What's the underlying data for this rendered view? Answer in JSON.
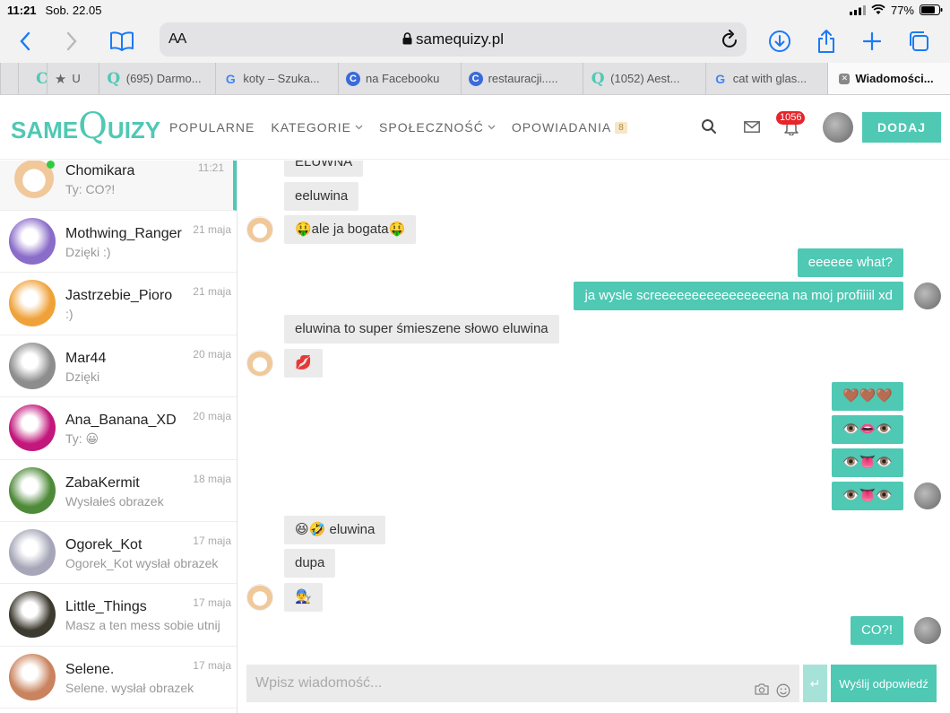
{
  "status": {
    "time": "11:21",
    "date": "Sob. 22.05",
    "battery": "77%"
  },
  "browser": {
    "aa_label": "AA",
    "url": "samequizy.pl",
    "tabs": [
      {
        "label": "U",
        "fav": "Q",
        "favtype": "q"
      },
      {
        "label": "(695) Darmo...",
        "fav": "Q",
        "favtype": "q"
      },
      {
        "label": "koty – Szuka...",
        "fav": "G",
        "favtype": "g"
      },
      {
        "label": "na Facebooku",
        "fav": "C",
        "favtype": "c"
      },
      {
        "label": "restauracji.....",
        "fav": "C",
        "favtype": "c"
      },
      {
        "label": "(1052) Aest...",
        "fav": "Q",
        "favtype": "q"
      },
      {
        "label": "cat with glas...",
        "fav": "G",
        "favtype": "g"
      },
      {
        "label": "Wiadomości...",
        "fav": "✕",
        "favtype": "x"
      }
    ]
  },
  "site": {
    "logo_small": "SAME",
    "logo_big": "Q",
    "logo_rest": "UIZY",
    "nav": {
      "popularne": "POPULARNE",
      "kategorie": "KATEGORIE",
      "spolecznosc": "SPOŁECZNOŚĆ",
      "opowiadania": "OPOWIADANIA",
      "opowiadania_count": "8"
    },
    "notifications": "1056",
    "add_label": "DODAJ"
  },
  "conversations": [
    {
      "name": "Chomikara",
      "preview": "Ty: CO?!",
      "date": "11:21",
      "color": "#f3d6b4"
    },
    {
      "name": "Mothwing_Ranger",
      "preview": "Dzięki :)",
      "date": "21 maja",
      "color": "#8a6cc9"
    },
    {
      "name": "Jastrzebie_Pioro",
      "preview": ":)",
      "date": "21 maja",
      "color": "#f0a23a"
    },
    {
      "name": "Mar44",
      "preview": "Dzięki",
      "date": "20 maja",
      "color": "#8d8d8d"
    },
    {
      "name": "Ana_Banana_XD",
      "preview": "Ty: 😀",
      "date": "20 maja",
      "color": "#c2187c"
    },
    {
      "name": "ZabaKermit",
      "preview": "Wysłałeś obrazek",
      "date": "18 maja",
      "color": "#4f8a3a"
    },
    {
      "name": "Ogorek_Kot",
      "preview": "Ogorek_Kot wysłał obrazek",
      "date": "17 maja",
      "color": "#a6a6b8"
    },
    {
      "name": "Little_Things",
      "preview": "Masz a ten mess sobie utnij",
      "date": "17 maja",
      "color": "#3d3a2f"
    },
    {
      "name": "Selene.",
      "preview": "Selene. wysłał obrazek",
      "date": "17 maja",
      "color": "#c9835e"
    }
  ],
  "messages": [
    "ELUWNA",
    "eeluwina",
    "🤑ale ja bogata🤑",
    "eeeeee what?",
    "ja wysle screeeeeeeeeeeeeeeena na moj profiiiil xd",
    "eluwina to super śmieszene słowo eluwina",
    "💋",
    "🤎🤎🤎",
    "👁️👄👁️",
    "👁️👅👁️",
    "👁️👅👁️",
    "😆🤣 eluwina",
    "dupa",
    "👨‍🔧",
    "CO?!"
  ],
  "composer": {
    "placeholder": "Wpisz wiadomość...",
    "enter_symbol": "↵",
    "send_label": "Wyślij odpowiedź"
  }
}
